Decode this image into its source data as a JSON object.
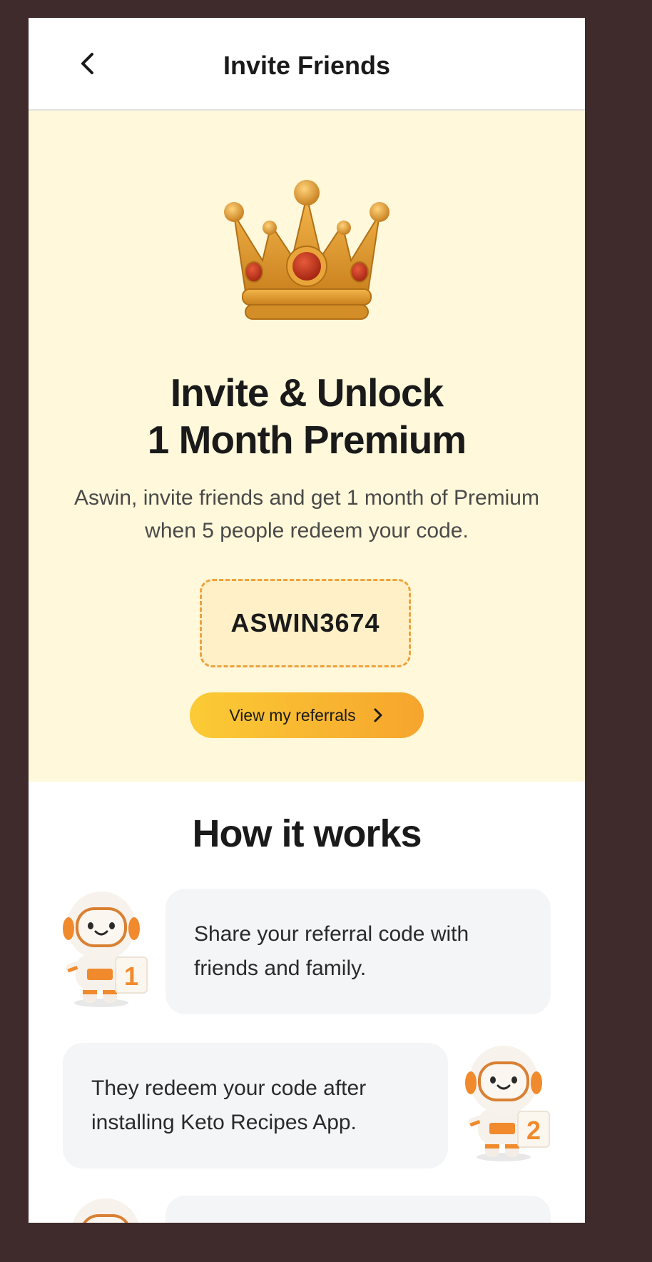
{
  "header": {
    "title": "Invite Friends"
  },
  "hero": {
    "title_line1": "Invite & Unlock",
    "title_line2": "1 Month Premium",
    "subtitle": "Aswin, invite friends and get 1 month of Premium when 5 people redeem your code.",
    "referral_code": "ASWIN3674",
    "referrals_button": "View my referrals"
  },
  "how_it_works": {
    "title": "How it works",
    "steps": [
      {
        "number": "1",
        "text": "Share your referral code with friends and family."
      },
      {
        "number": "2",
        "text": "They redeem your code after installing Keto Recipes App."
      },
      {
        "number": "",
        "text": ""
      }
    ]
  },
  "colors": {
    "hero_background": "#fff8da",
    "accent_orange": "#f0a13a",
    "button_gradient_start": "#fbcb35",
    "button_gradient_end": "#f6a52d",
    "card_background": "#f4f5f7",
    "page_frame": "#3f2b2c"
  },
  "icons": {
    "back": "chevron-left-icon",
    "crown": "crown-icon",
    "button_arrow": "chevron-right-icon",
    "astronaut": "astronaut-mascot-icon"
  }
}
